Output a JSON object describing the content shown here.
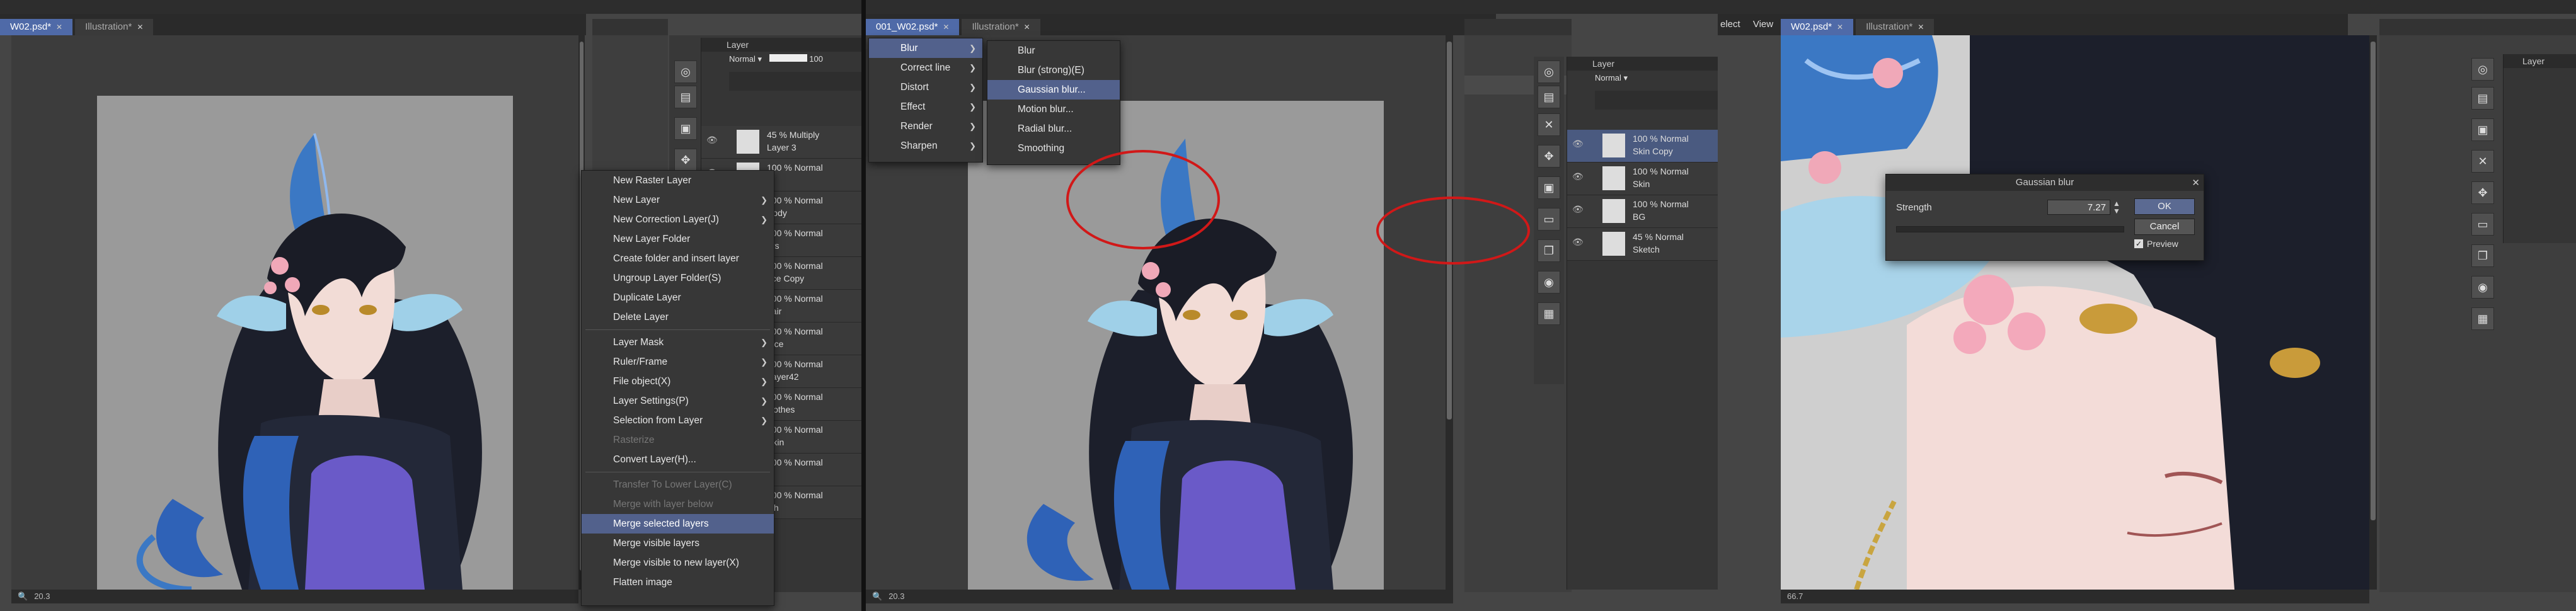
{
  "panel1": {
    "tabs": [
      {
        "label": "W02.psd*",
        "active": true
      },
      {
        "label": "Illustration*",
        "active": false
      }
    ],
    "zoom": "20.3",
    "context_menu": [
      {
        "label": "New Raster Layer"
      },
      {
        "label": "New Layer",
        "submenu": true
      },
      {
        "label": "New Correction Layer(J)",
        "submenu": true
      },
      {
        "label": "New Layer Folder"
      },
      {
        "label": "Create folder and insert layer"
      },
      {
        "label": "Ungroup Layer Folder(S)"
      },
      {
        "label": "Duplicate Layer"
      },
      {
        "label": "Delete Layer"
      },
      {
        "sep": true
      },
      {
        "label": "Layer Mask",
        "submenu": true
      },
      {
        "label": "Ruler/Frame",
        "submenu": true
      },
      {
        "label": "File object(X)",
        "submenu": true
      },
      {
        "label": "Layer Settings(P)",
        "submenu": true
      },
      {
        "label": "Selection from Layer",
        "submenu": true
      },
      {
        "label": "Rasterize",
        "disabled": true
      },
      {
        "label": "Convert Layer(H)..."
      },
      {
        "sep": true
      },
      {
        "label": "Transfer To Lower Layer(C)",
        "disabled": true
      },
      {
        "label": "Merge with layer below",
        "disabled": true
      },
      {
        "label": "Merge selected layers",
        "highlight": true
      },
      {
        "label": "Merge visible layers"
      },
      {
        "label": "Merge visible to new layer(X)"
      },
      {
        "label": "Flatten image"
      }
    ],
    "layers": [
      {
        "t1": "45 % Multiply",
        "t2": "Layer 3"
      },
      {
        "t1": "100 % Normal",
        "t2": ""
      },
      {
        "t1": "100 % Normal",
        "t2": "Body"
      },
      {
        "t1": "100 % Normal",
        "t2": "ars"
      },
      {
        "t1": "100 % Normal",
        "t2": "ace Copy"
      },
      {
        "t1": "100 % Normal",
        "t2": "hair"
      },
      {
        "t1": "100 % Normal",
        "t2": "face"
      },
      {
        "t1": "100 % Normal",
        "t2": "Layer42"
      },
      {
        "t1": "100 % Normal",
        "t2": "clothes"
      },
      {
        "t1": "100 % Normal",
        "t2": "Skin"
      },
      {
        "t1": "100 % Normal",
        "t2": ""
      },
      {
        "t1": "100 % Normal",
        "t2": "tch"
      }
    ],
    "layer_panel_title": "Layer",
    "blend_mode": "Normal",
    "opacity": "100"
  },
  "panel2": {
    "tabs": [
      {
        "label": "001_W02.psd*",
        "active": true
      },
      {
        "label": "Illustration*",
        "active": false
      }
    ],
    "zoom": "20.3",
    "filter_menu": [
      {
        "label": "Blur",
        "submenu": true,
        "highlight": true
      },
      {
        "label": "Correct line",
        "submenu": true
      },
      {
        "label": "Distort",
        "submenu": true
      },
      {
        "label": "Effect",
        "submenu": true
      },
      {
        "label": "Render",
        "submenu": true
      },
      {
        "label": "Sharpen",
        "submenu": true
      }
    ],
    "blur_submenu": [
      {
        "label": "Blur"
      },
      {
        "label": "Blur (strong)(E)"
      },
      {
        "label": "Gaussian blur...",
        "highlight": true
      },
      {
        "label": "Motion blur..."
      },
      {
        "label": "Radial blur..."
      },
      {
        "label": "Smoothing"
      }
    ],
    "layer_panel_title": "Layer",
    "blend_mode": "Normal",
    "layers": [
      {
        "t1": "100 % Normal",
        "t2": "Skin Copy",
        "selected": true
      },
      {
        "t1": "100 % Normal",
        "t2": "Skin"
      },
      {
        "t1": "100 % Normal",
        "t2": "BG"
      },
      {
        "t1": "45 % Normal",
        "t2": "Sketch"
      }
    ]
  },
  "panel3": {
    "tabs": [
      {
        "label": "W02.psd*",
        "active": true
      },
      {
        "label": "Illustration*",
        "active": false
      }
    ],
    "menu_fragments": [
      "elect",
      "View"
    ],
    "zoom": "66.7",
    "dialog": {
      "title": "Gaussian blur",
      "strength_label": "Strength",
      "strength_value": "7.27",
      "ok": "OK",
      "cancel": "Cancel",
      "preview": "Preview",
      "preview_checked": true,
      "strength_fraction": 0.0
    },
    "layer_panel_title": "Layer"
  },
  "colors": {
    "menu_highlight": "#52618c",
    "tab_active": "#4f6aa8",
    "annotation_red": "#d11818",
    "hair_blue": "#2f62b7",
    "horn_blue": "#3b78c4"
  }
}
